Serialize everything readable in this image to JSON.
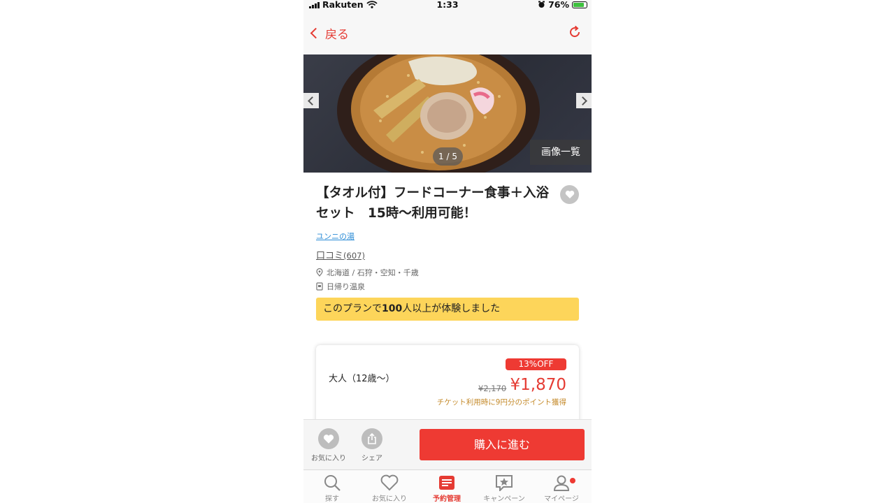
{
  "status_bar": {
    "carrier": "Rakuten",
    "time": "1:33",
    "battery": "76%"
  },
  "nav": {
    "back_label": "戻る",
    "reload_icon": "reload-icon"
  },
  "gallery": {
    "counter": "1 / 5",
    "view_all_label": "画像一覧"
  },
  "plan": {
    "title": "【タオル付】フードコーナー食事＋入浴セット　15時〜利用可能！",
    "facility_name": "ユンニの湯",
    "reviews_label": "口コミ",
    "reviews_count": "(607)",
    "location": "北海道 / 石狩・空知・千歳",
    "category": "日帰り温泉",
    "experience_prefix": "このプランで",
    "experience_count": "100",
    "experience_suffix": "人以上が体験しました"
  },
  "price": {
    "age_label": "大人（12歳〜）",
    "discount_badge": "13%OFF",
    "original_price": "¥2,170",
    "price": "¥1,870",
    "points_note": "チケット利用時に9円分のポイント獲得"
  },
  "actions": {
    "favorite_label": "お気に入り",
    "share_label": "シェア",
    "buy_label": "購入に進む"
  },
  "tabs": [
    {
      "label": "探す",
      "icon": "search-icon"
    },
    {
      "label": "お気に入り",
      "icon": "heart-icon"
    },
    {
      "label": "予約管理",
      "icon": "reservation-icon"
    },
    {
      "label": "キャンペーン",
      "icon": "campaign-icon"
    },
    {
      "label": "マイページ",
      "icon": "user-icon"
    }
  ],
  "colors": {
    "accent": "#ee3a33",
    "banner": "#fdd55a",
    "link": "#2a8bd6",
    "points": "#c48a2a"
  }
}
